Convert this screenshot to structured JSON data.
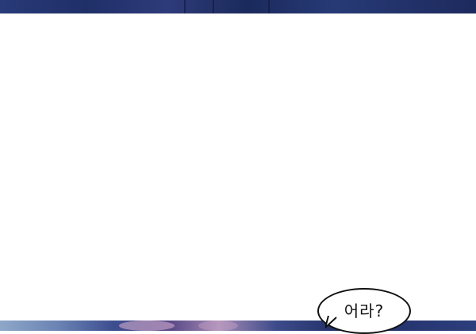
{
  "speech_bubble": {
    "text": "어라?"
  }
}
